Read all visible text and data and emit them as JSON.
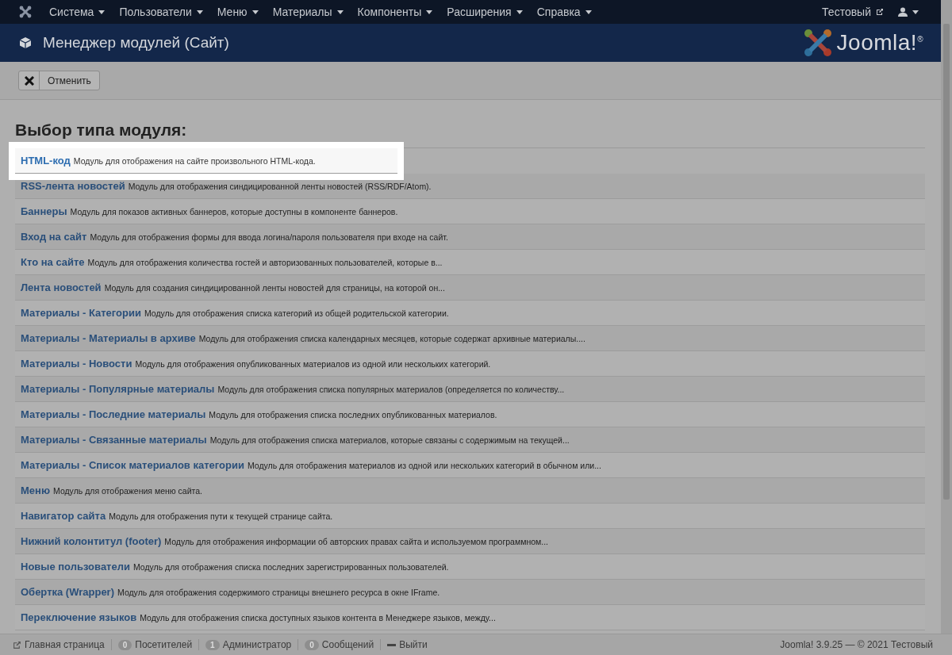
{
  "navbar": {
    "menus": [
      "Система",
      "Пользователи",
      "Меню",
      "Материалы",
      "Компоненты",
      "Расширения",
      "Справка"
    ],
    "site_link": "Тестовый"
  },
  "header": {
    "title": "Менеджер модулей (Сайт)",
    "logo_text": "Joomla!",
    "logo_mark": "®"
  },
  "toolbar": {
    "cancel_button": "Отменить"
  },
  "heading": "Выбор типа модуля:",
  "modules": [
    {
      "name": "HTML-код",
      "description": "Модуль для отображения на сайте произвольного HTML-кода.",
      "selected": true
    },
    {
      "name": "RSS-лента новостей",
      "description": "Модуль для отображения синдицированной ленты новостей (RSS/RDF/Atom).",
      "selected": false
    },
    {
      "name": "Баннеры",
      "description": "Модуль для показов активных баннеров, которые доступны в компоненте баннеров.",
      "selected": false
    },
    {
      "name": "Вход на сайт",
      "description": "Модуль для отображения формы для ввода логина/пароля пользователя при входе на сайт.",
      "selected": false
    },
    {
      "name": "Кто на сайте",
      "description": "Модуль для отображения количества гостей и авторизованных пользователей, которые в...",
      "selected": false
    },
    {
      "name": "Лента новостей",
      "description": "Модуль для создания синдицированной ленты новостей для страницы, на которой он...",
      "selected": false
    },
    {
      "name": "Материалы - Категории",
      "description": "Модуль для отображения списка категорий из общей родительской категории.",
      "selected": false
    },
    {
      "name": "Материалы - Материалы в архиве",
      "description": "Модуль для отображения списка календарных месяцев, которые содержат архивные материалы....",
      "selected": false
    },
    {
      "name": "Материалы - Новости",
      "description": "Модуль для отображения опубликованных материалов из одной или нескольких категорий.",
      "selected": false
    },
    {
      "name": "Материалы - Популярные материалы",
      "description": "Модуль для отображения списка популярных материалов (определяется по количеству...",
      "selected": false
    },
    {
      "name": "Материалы - Последние материалы",
      "description": "Модуль для отображения списка последних опубликованных материалов.",
      "selected": false
    },
    {
      "name": "Материалы - Связанные материалы",
      "description": "Модуль для отображения списка материалов, которые связаны с содержимым на текущей...",
      "selected": false
    },
    {
      "name": "Материалы - Список материалов категории",
      "description": "Модуль для отображения материалов из одной или нескольких категорий в обычном или...",
      "selected": false
    },
    {
      "name": "Меню",
      "description": "Модуль для отображения меню сайта.",
      "selected": false
    },
    {
      "name": "Навигатор сайта",
      "description": "Модуль для отображения пути к текущей странице сайта.",
      "selected": false
    },
    {
      "name": "Нижний колонтитул (footer)",
      "description": "Модуль для отображения информации об авторских правах сайта и используемом программном...",
      "selected": false
    },
    {
      "name": "Новые пользователи",
      "description": "Модуль для отображения списка последних зарегистрированных пользователей.",
      "selected": false
    },
    {
      "name": "Обертка (Wrapper)",
      "description": "Модуль для отображения содержимого страницы внешнего ресурса в окне IFrame.",
      "selected": false
    },
    {
      "name": "Переключение языков",
      "description": "Модуль для отображения списка доступных языков контента в Менеджере языков, между...",
      "selected": false
    }
  ],
  "status_bar": {
    "home_link": "Главная страница",
    "visitors": {
      "count": "0",
      "label": "Посетителей"
    },
    "admins": {
      "count": "1",
      "label": "Администратор"
    },
    "messages": {
      "count": "0",
      "label": "Сообщений"
    },
    "logout": "Выйти",
    "copyright": "Joomla! 3.9.25 — © 2021 Тестовый"
  }
}
